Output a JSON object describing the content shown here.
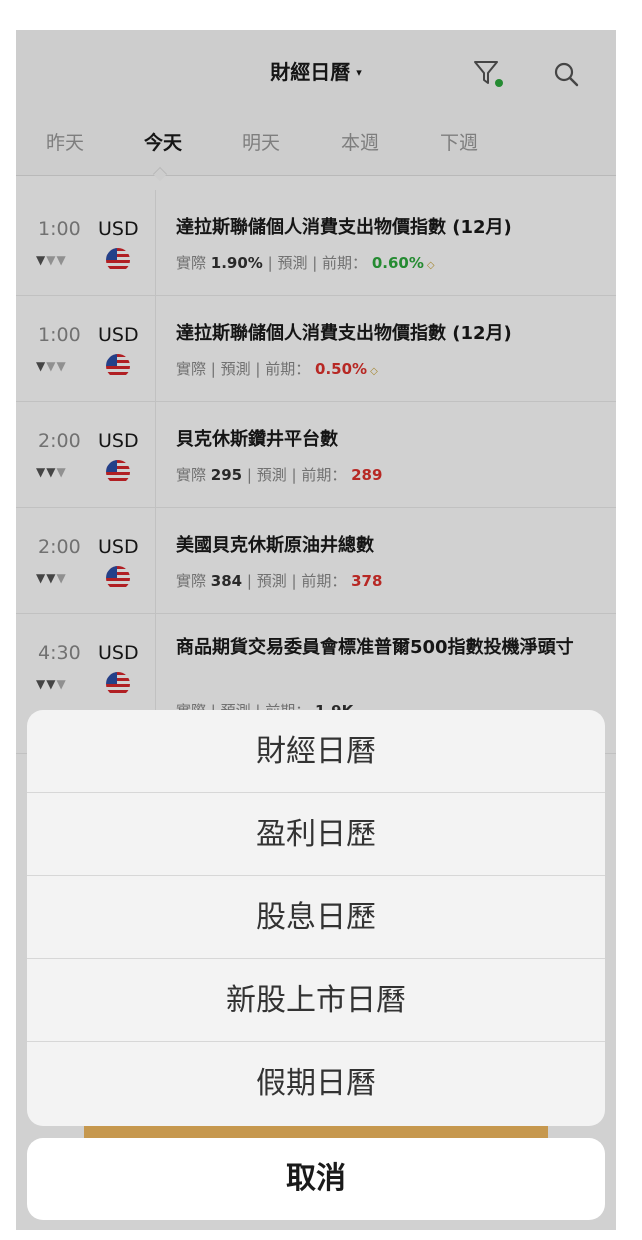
{
  "header": {
    "title": "財經日曆",
    "title_caret": "▾",
    "filter_icon": "filter-icon",
    "filter_dot_color": "#2eaa3d",
    "search_icon": "search-icon"
  },
  "tabs": [
    {
      "label": "昨天",
      "active": false
    },
    {
      "label": "今天",
      "active": true
    },
    {
      "label": "明天",
      "active": false
    },
    {
      "label": "本週",
      "active": false
    },
    {
      "label": "下週",
      "active": false
    }
  ],
  "events": [
    {
      "time": "1:00",
      "currency": "USD",
      "importance": 1,
      "title": "達拉斯聯儲個人消費支出物價指數 (12月)",
      "actual_label": "實際",
      "actual": "1.90%",
      "forecast_label": "預測",
      "forecast": "",
      "previous_label": "前期：",
      "previous": "0.60%",
      "previous_color": "green",
      "previous_marker": "◇"
    },
    {
      "time": "1:00",
      "currency": "USD",
      "importance": 1,
      "title": "達拉斯聯儲個人消費支出物價指數 (12月)",
      "actual_label": "實際",
      "actual": "",
      "forecast_label": "預測",
      "forecast": "",
      "previous_label": "前期：",
      "previous": "0.50%",
      "previous_color": "red",
      "previous_marker": "◇"
    },
    {
      "time": "2:00",
      "currency": "USD",
      "importance": 2,
      "title": "貝克休斯鑽井平台數",
      "actual_label": "實際",
      "actual": "295",
      "forecast_label": "預測",
      "forecast": "",
      "previous_label": "前期：",
      "previous": "289",
      "previous_color": "red",
      "previous_marker": ""
    },
    {
      "time": "2:00",
      "currency": "USD",
      "importance": 2,
      "title": "美國貝克休斯原油井總數",
      "actual_label": "實際",
      "actual": "384",
      "forecast_label": "預測",
      "forecast": "",
      "previous_label": "前期：",
      "previous": "378",
      "previous_color": "red",
      "previous_marker": ""
    },
    {
      "time": "4:30",
      "currency": "USD",
      "importance": 2,
      "title": "商品期貨交易委員會標准普爾500指數投機淨頭寸",
      "actual_label": "實際",
      "actual": "",
      "forecast_label": "預測",
      "forecast": "",
      "previous_label": "前期：",
      "previous": "1.9K",
      "previous_color": "dark",
      "previous_marker": ""
    }
  ],
  "action_sheet": {
    "items": [
      "財經日曆",
      "盈利日歷",
      "股息日歷",
      "新股上市日曆",
      "假期日曆"
    ],
    "cancel_label": "取消"
  }
}
